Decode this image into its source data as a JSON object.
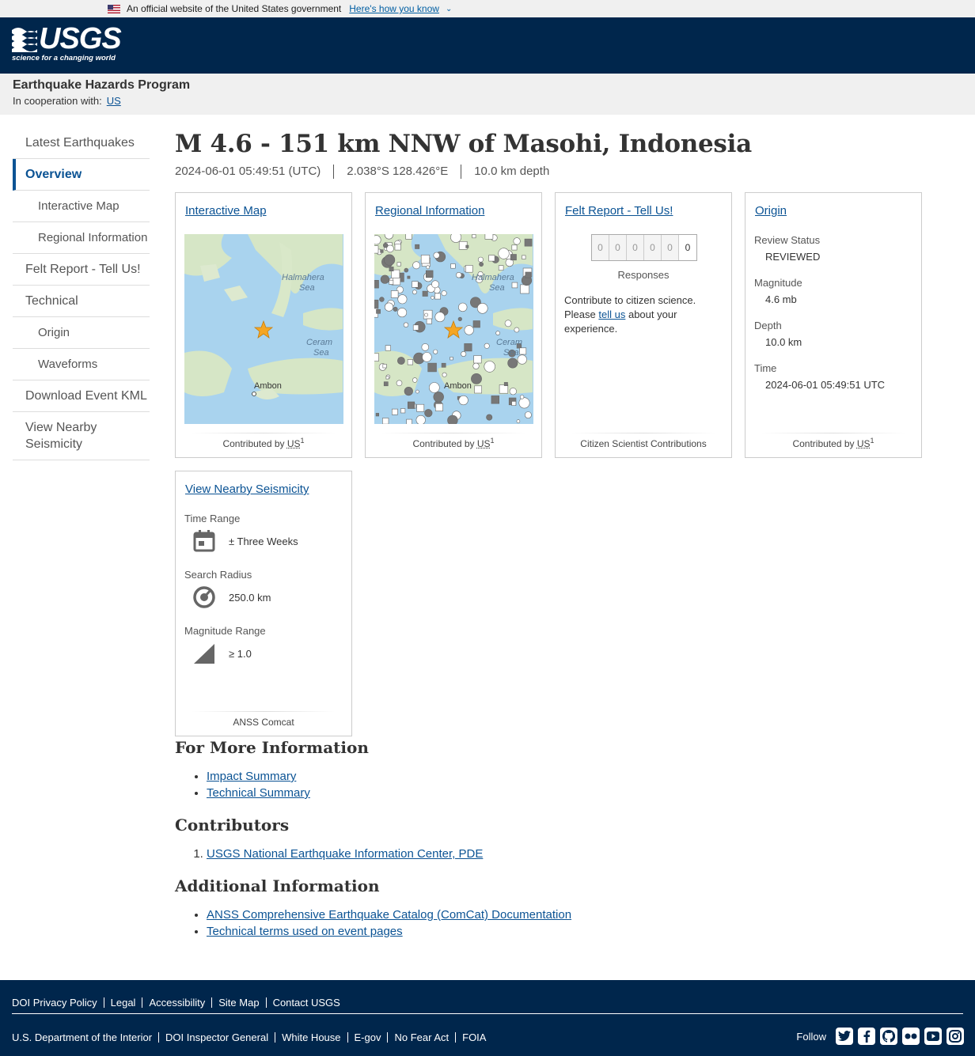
{
  "gov_banner": {
    "text": "An official website of the United States government",
    "link": "Here's how you know"
  },
  "logo": {
    "word": "USGS",
    "tagline": "science for a changing world"
  },
  "program": {
    "title": "Earthquake Hazards Program",
    "coop_label": "In cooperation with:",
    "coop_link": "US"
  },
  "sidebar": {
    "items": [
      {
        "label": "Latest Earthquakes"
      },
      {
        "label": "Overview"
      },
      {
        "label": "Interactive Map"
      },
      {
        "label": "Regional Information"
      },
      {
        "label": "Felt Report - Tell Us!"
      },
      {
        "label": "Technical"
      },
      {
        "label": "Origin"
      },
      {
        "label": "Waveforms"
      },
      {
        "label": "Download Event KML"
      },
      {
        "label": "View Nearby Seismicity"
      }
    ]
  },
  "event": {
    "title": "M 4.6 - 151 km NNW of Masohi, Indonesia",
    "time": "2024-06-01 05:49:51 (UTC)",
    "coords": "2.038°S 128.426°E",
    "depth": "10.0 km depth"
  },
  "cards": {
    "map": {
      "head": "Interactive Map",
      "foot_prefix": "Contributed by",
      "foot_abbr": "US",
      "foot_sup": "1",
      "labels": {
        "halmahera_1": "Halmahera",
        "halmahera_2": "Sea",
        "ceram_1": "Ceram",
        "ceram_2": "Sea",
        "ambon": "Ambon"
      }
    },
    "regional": {
      "head": "Regional Information",
      "foot_prefix": "Contributed by",
      "foot_abbr": "US",
      "foot_sup": "1",
      "labels": {
        "halmahera_1": "Halmahera",
        "halmahera_2": "Sea",
        "ceram_1": "Ceram",
        "ceram_2": "Sea",
        "ambon": "Ambon"
      }
    },
    "dyfi": {
      "head": "Felt Report - Tell Us!",
      "digits": [
        "0",
        "0",
        "0",
        "0",
        "0",
        "0"
      ],
      "responses": "Responses",
      "text_1": "Contribute to citizen science. Please",
      "link": "tell us",
      "text_2": "about your experience.",
      "foot": "Citizen Scientist Contributions"
    },
    "origin": {
      "head": "Origin",
      "review_label": "Review Status",
      "review_value": "REVIEWED",
      "mag_label": "Magnitude",
      "mag_value": "4.6 mb",
      "depth_label": "Depth",
      "depth_value": "10.0 km",
      "time_label": "Time",
      "time_value": "2024-06-01 05:49:51 UTC",
      "foot_prefix": "Contributed by",
      "foot_abbr": "US",
      "foot_sup": "1"
    },
    "seismicity": {
      "head": "View Nearby Seismicity",
      "time_label": "Time Range",
      "time_value": "± Three Weeks",
      "radius_label": "Search Radius",
      "radius_value": "250.0 km",
      "mag_label": "Magnitude Range",
      "mag_value": "≥ 1.0",
      "foot": "ANSS Comcat"
    }
  },
  "more_info": {
    "title": "For More Information",
    "links": [
      "Impact Summary",
      "Technical Summary"
    ]
  },
  "contributors": {
    "title": "Contributors",
    "items": [
      "USGS National Earthquake Information Center, PDE"
    ]
  },
  "additional": {
    "title": "Additional Information",
    "links": [
      "ANSS Comprehensive Earthquake Catalog (ComCat) Documentation",
      "Technical terms used on event pages"
    ]
  },
  "footer": {
    "row1": [
      "DOI Privacy Policy",
      "Legal",
      "Accessibility",
      "Site Map",
      "Contact USGS"
    ],
    "row2": [
      "U.S. Department of the Interior",
      "DOI Inspector General",
      "White House",
      "E-gov",
      "No Fear Act",
      "FOIA"
    ],
    "follow": "Follow",
    "social_icons": [
      "twitter-icon",
      "facebook-icon",
      "github-icon",
      "flickr-icon",
      "youtube-icon",
      "instagram-icon"
    ]
  },
  "colors": {
    "header_bg": "#00264c",
    "link": "#0b5394",
    "star": "#f5a623"
  }
}
